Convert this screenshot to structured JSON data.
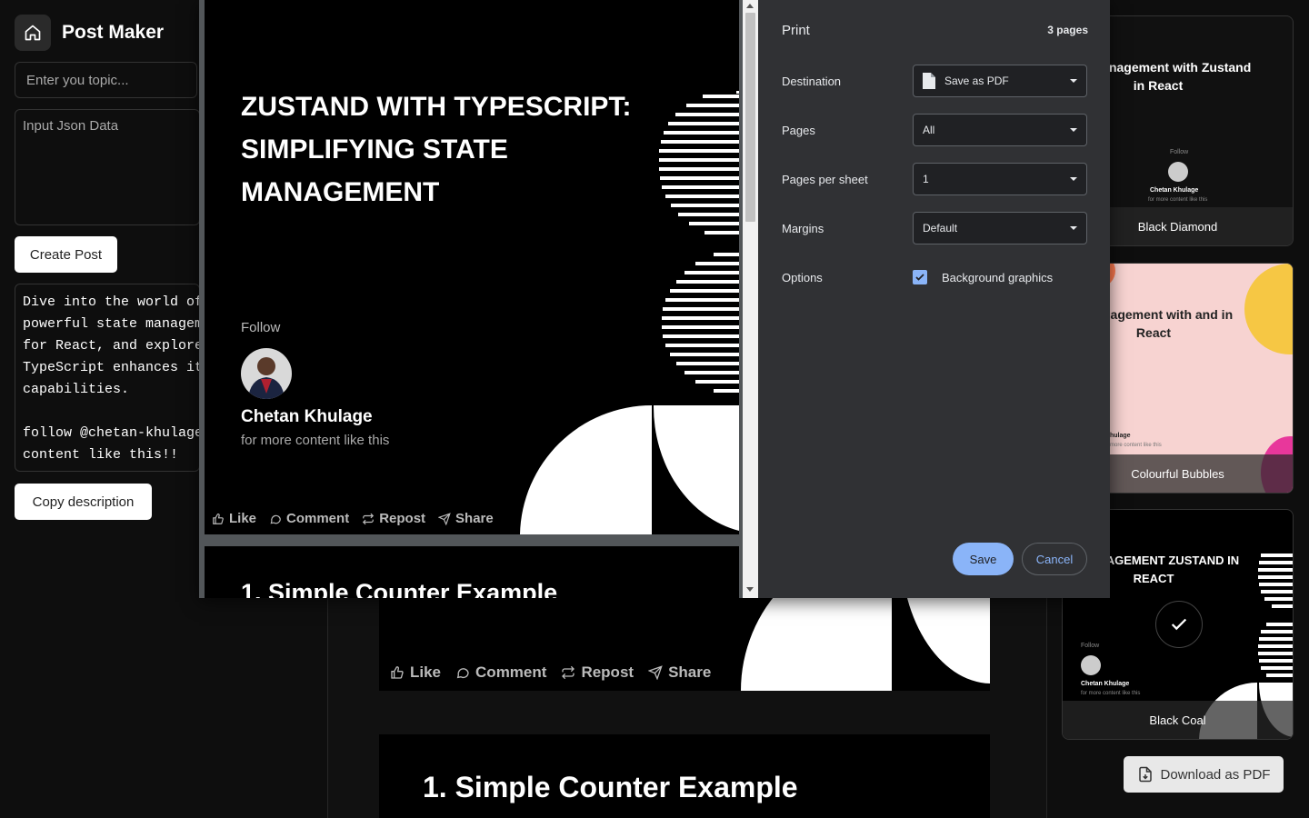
{
  "app": {
    "title": "Post Maker",
    "home_icon": "home-icon"
  },
  "sidebar": {
    "topic_placeholder": "Enter you topic...",
    "json_placeholder": "Input Json Data",
    "create_label": "Create Post",
    "description": "Dive into the world of\npowerful state managem\nfor React, and explore\nTypeScript enhances it\ncapabilities.\n\nfollow @chetan-khulage\ncontent like this!!",
    "copy_label": "Copy description"
  },
  "post": {
    "title": "ZUSTAND WITH TYPESCRIPT: SIMPLIFYING STATE MANAGEMENT",
    "follow": "Follow",
    "author": "Chetan Khulage",
    "tagline": "for more content like this",
    "actions": [
      "Like",
      "Comment",
      "Repost",
      "Share"
    ],
    "next_slide_title": "1. Simple Counter Example"
  },
  "templates": [
    {
      "name": "Black Diamond",
      "preview_title": "tate Management with Zustand in React",
      "follow": "Follow",
      "author": "Chetan Khulage",
      "tagline": "for more content like this"
    },
    {
      "name": "Colourful Bubbles",
      "preview_title": "e Management with and in React",
      "author": "hulage",
      "tagline": "more content like this"
    },
    {
      "name": "Black Coal",
      "preview_title": "E MANAGEMENT ZUSTAND IN REACT",
      "follow": "Follow",
      "author": "Chetan Khulage",
      "tagline": "for more content like this",
      "selected": true
    }
  ],
  "download_label": "Download as PDF",
  "print_dialog": {
    "title": "Print",
    "page_count": "3 pages",
    "destination_label": "Destination",
    "destination_value": "Save as PDF",
    "pages_label": "Pages",
    "pages_value": "All",
    "pps_label": "Pages per sheet",
    "pps_value": "1",
    "margins_label": "Margins",
    "margins_value": "Default",
    "options_label": "Options",
    "background_graphics": "Background graphics",
    "save_label": "Save",
    "cancel_label": "Cancel"
  },
  "colors": {
    "accent": "#8ab4f8",
    "dialog_bg": "#303134",
    "page_bg": "#000000",
    "app_bg": "#0e0e0e"
  }
}
